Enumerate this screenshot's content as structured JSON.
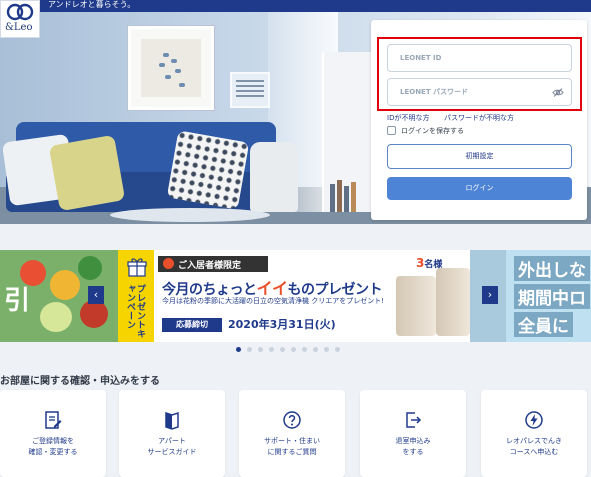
{
  "header": {
    "logo_text": "&Leo",
    "tagline": "アンドレオと暮らそう。"
  },
  "login": {
    "id_placeholder": "LEONET ID",
    "password_placeholder": "LEONET パスワード",
    "forgot_id": "IDが不明な方",
    "forgot_password": "パスワードが不明な方",
    "remember_label": "ログインを保存する",
    "initial_setup_label": "初期設定",
    "login_label": "ログイン"
  },
  "carousel": {
    "left_slide_text": "引",
    "badge": "ご入居者様限定",
    "stripe_text": "プレゼントキャンペーン",
    "title_pre": "今月のちょっと",
    "title_highlight": "イイ",
    "title_post": "ものプレゼント",
    "subtitle": "今月は花粉の季節に大活躍の日立の空気清浄機 クリエアをプレゼント!",
    "deadline_label": "応募締切",
    "deadline": "2020年3月31日(火)",
    "count_number": "3",
    "count_unit": "名様",
    "right_lines": [
      "外出しな",
      "期間中ロ",
      "全員に"
    ],
    "prev": "‹",
    "next": "›",
    "slide_count": 10,
    "active_slide": 0
  },
  "section": {
    "title": "お部屋に関する確認・申込みをする",
    "cards": [
      {
        "label": "ご登録情報を\n確認・変更する",
        "icon": "edit-document-icon"
      },
      {
        "label": "アパート\nサービスガイド",
        "icon": "guide-book-icon"
      },
      {
        "label": "サポート・住まい\nに関するご質問",
        "icon": "question-icon"
      },
      {
        "label": "退室申込み\nをする",
        "icon": "exit-icon"
      },
      {
        "label": "レオパレスでんき\nコースへ申込む",
        "icon": "lightning-icon"
      }
    ]
  },
  "colors": {
    "navy": "#1f3a8a",
    "login_blue": "#4e84d6",
    "highlight_red": "#e2000f",
    "campaign_yellow": "#f5d400",
    "accent_orange": "#e94f2a"
  }
}
